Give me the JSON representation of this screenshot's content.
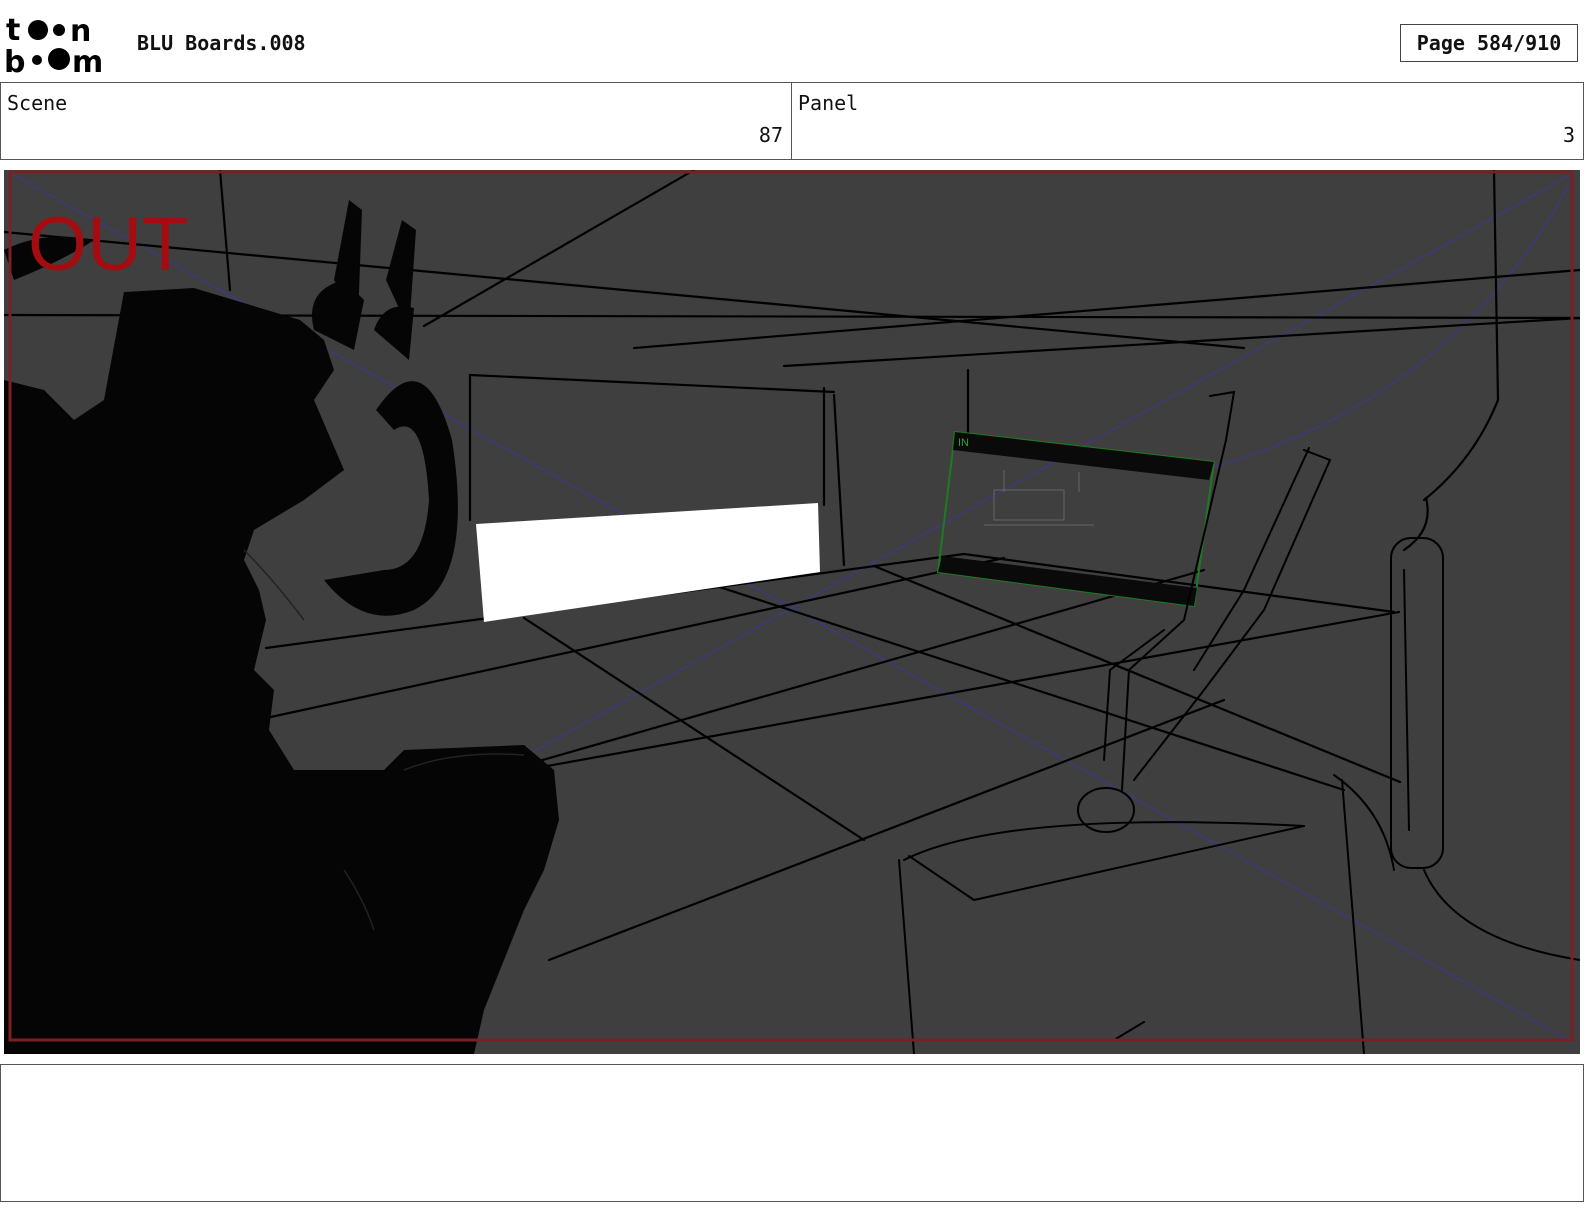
{
  "header": {
    "logo_text": "toon boom",
    "document_title": "BLU Boards.008",
    "page_label": "Page 584/910"
  },
  "info": {
    "scene_label": "Scene",
    "scene_value": "87",
    "panel_label": "Panel",
    "panel_value": "3"
  },
  "panel_image": {
    "out_label": "OUT",
    "in_label": "IN",
    "colors": {
      "background": "#3f3f3f",
      "silhouette": "#050505",
      "out_text": "#a30d12",
      "frame_border": "#7a1f24",
      "camera_in_frame": "#1e7a22",
      "guide_lines": "#3a3a8a",
      "light_window": "#ffffff"
    }
  },
  "notes": {
    "text": ""
  }
}
